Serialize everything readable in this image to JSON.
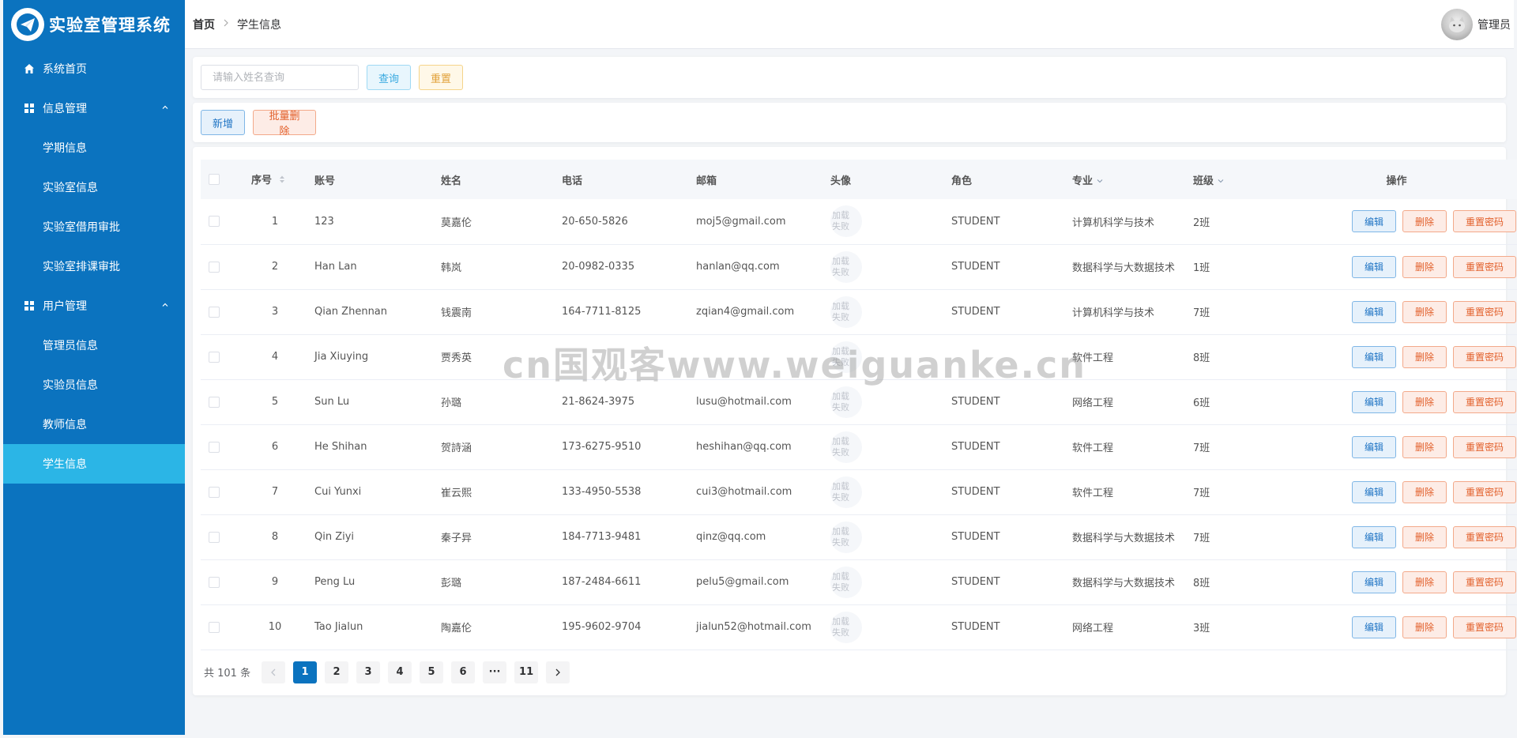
{
  "app": {
    "title": "实验室管理系统",
    "accent": "#0b73bf",
    "active_color": "#2bb5e6"
  },
  "sidebar": {
    "items": [
      {
        "label": "系统首页",
        "icon": "home-icon"
      },
      {
        "label": "信息管理",
        "icon": "grid-icon",
        "expanded": true,
        "children": [
          "学期信息",
          "实验室信息",
          "实验室借用审批",
          "实验室排课审批"
        ]
      },
      {
        "label": "用户管理",
        "icon": "grid-icon",
        "expanded": true,
        "children": [
          "管理员信息",
          "实验员信息",
          "教师信息",
          "学生信息"
        ]
      }
    ],
    "active": "学生信息"
  },
  "header": {
    "breadcrumb_home": "首页",
    "breadcrumb_current": "学生信息",
    "user_name": "管理员"
  },
  "search": {
    "placeholder": "请输入姓名查询",
    "query_label": "查询",
    "reset_label": "重置"
  },
  "ops": {
    "add_label": "新增",
    "batch_delete_label": "批量删除"
  },
  "table": {
    "columns": {
      "index": "序号",
      "account": "账号",
      "name": "姓名",
      "phone": "电话",
      "email": "邮箱",
      "avatar": "头像",
      "role": "角色",
      "major": "专业",
      "class": "班级",
      "actions": "操作"
    },
    "avatar_fail_text": [
      "加载",
      "失败"
    ],
    "row_actions": {
      "edit": "编辑",
      "delete": "删除",
      "reset_pwd": "重置密码"
    },
    "rows": [
      {
        "index": "1",
        "account": "123",
        "name": "莫嘉伦",
        "phone": "20-650-5826",
        "email": "moj5@gmail.com",
        "role": "STUDENT",
        "major": "计算机科学与技术",
        "class": "2班"
      },
      {
        "index": "2",
        "account": "Han Lan",
        "name": "韩岚",
        "phone": "20-0982-0335",
        "email": "hanlan@qq.com",
        "role": "STUDENT",
        "major": "数据科学与大数据技术",
        "class": "1班"
      },
      {
        "index": "3",
        "account": "Qian Zhennan",
        "name": "钱震南",
        "phone": "164-7711-8125",
        "email": "zqian4@gmail.com",
        "role": "STUDENT",
        "major": "计算机科学与技术",
        "class": "7班"
      },
      {
        "index": "4",
        "account": "Jia Xiuying",
        "name": "贾秀英",
        "phone": "",
        "email": "",
        "role": "",
        "major": "软件工程",
        "class": "8班"
      },
      {
        "index": "5",
        "account": "Sun Lu",
        "name": "孙璐",
        "phone": "21-8624-3975",
        "email": "lusu@hotmail.com",
        "role": "STUDENT",
        "major": "网络工程",
        "class": "6班"
      },
      {
        "index": "6",
        "account": "He Shihan",
        "name": "贺詩涵",
        "phone": "173-6275-9510",
        "email": "heshihan@qq.com",
        "role": "STUDENT",
        "major": "软件工程",
        "class": "7班"
      },
      {
        "index": "7",
        "account": "Cui Yunxi",
        "name": "崔云熙",
        "phone": "133-4950-5538",
        "email": "cui3@hotmail.com",
        "role": "STUDENT",
        "major": "软件工程",
        "class": "7班"
      },
      {
        "index": "8",
        "account": "Qin Ziyi",
        "name": "秦子异",
        "phone": "184-7713-9481",
        "email": "qinz@qq.com",
        "role": "STUDENT",
        "major": "数据科学与大数据技术",
        "class": "7班"
      },
      {
        "index": "9",
        "account": "Peng Lu",
        "name": "彭璐",
        "phone": "187-2484-6611",
        "email": "pelu5@gmail.com",
        "role": "STUDENT",
        "major": "数据科学与大数据技术",
        "class": "8班"
      },
      {
        "index": "10",
        "account": "Tao Jialun",
        "name": "陶嘉伦",
        "phone": "195-9602-9704",
        "email": "jialun52@hotmail.com",
        "role": "STUDENT",
        "major": "网络工程",
        "class": "3班"
      }
    ]
  },
  "pagination": {
    "total_text": "共 101 条",
    "pages": [
      "1",
      "2",
      "3",
      "4",
      "5",
      "6",
      "···",
      "11"
    ],
    "current": "1"
  },
  "watermark": "cn国观客www.weiguanke.cn"
}
